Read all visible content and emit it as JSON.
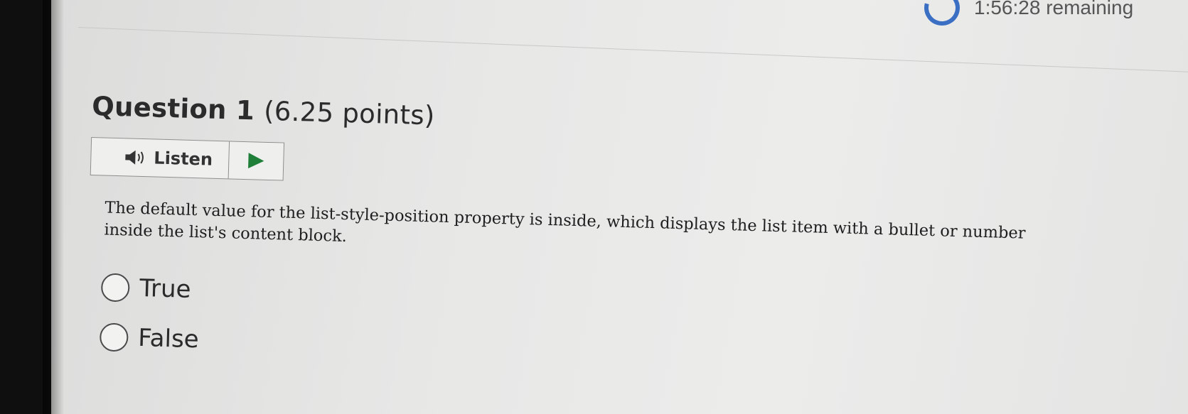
{
  "timer": {
    "text": "1:56:28 remaining"
  },
  "question": {
    "title_number": "Question 1",
    "title_points": "(6.25 points)",
    "listen_label": "Listen",
    "text": "The default value for the list-style-position property is inside, which displays the list item with a bullet or number inside the list's content block.",
    "options": [
      {
        "label": "True"
      },
      {
        "label": "False"
      }
    ]
  },
  "icons": {
    "speaker": "speaker-icon",
    "play": "play-icon",
    "timer": "timer-progress-icon"
  },
  "colors": {
    "play_green": "#1f7f39",
    "timer_blue": "#3b6fc4"
  }
}
